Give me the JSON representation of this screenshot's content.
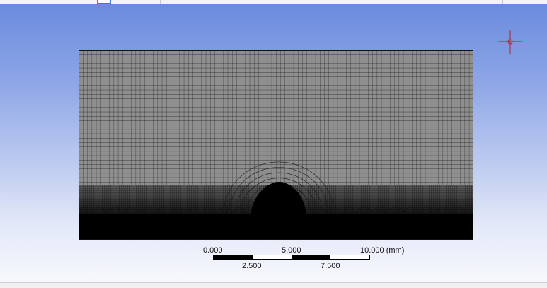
{
  "viewport": {
    "name": "graphics-viewport"
  },
  "scale_bar": {
    "upper_labels": [
      "0.000",
      "5.000",
      "10.000 (mm)"
    ],
    "lower_labels": [
      "2.500",
      "7.500"
    ],
    "segments": [
      "black",
      "white",
      "black",
      "white"
    ]
  },
  "colors": {
    "mesh_fill": "#8f8f8f",
    "mesh_line": "#1a1a1a",
    "dense_region": "#000000",
    "triad": "#b0243a",
    "background_top": "#6a8bde",
    "background_bottom": "#f7f8fd"
  },
  "icons": {
    "triad": "crosshair-triad-icon"
  }
}
